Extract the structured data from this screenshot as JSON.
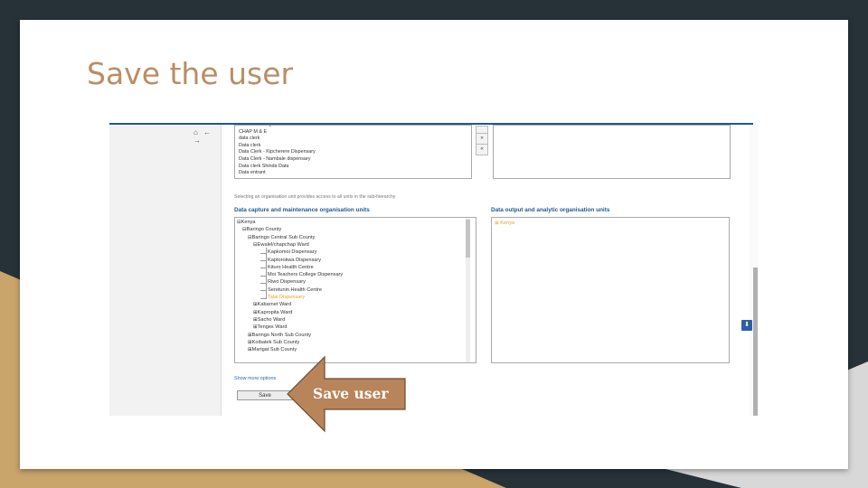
{
  "slide": {
    "title": "Save the user"
  },
  "nav": {
    "icons": [
      "home-icon",
      "back-arrow-icon",
      "forward-arrow-icon"
    ],
    "icons_text": "⌂ ← →"
  },
  "roles": {
    "available": [
      "CHAP IP Manger",
      "CHAP M & E",
      "data clerk",
      "Data clerk",
      "Data Clerk - Kipcherere Dispensary",
      "Data Clerk - Nambale dispensary",
      "Data clerk Shinda Data",
      "Data entrant"
    ],
    "move_buttons": [
      "»",
      "«"
    ]
  },
  "org": {
    "note": "Selecting an organisation unit provides access to all units in the sub-hierarchy",
    "capture_heading": "Data capture and maintenance organisation units",
    "output_heading": "Data output and analytic organisation units",
    "tree": [
      {
        "label": "⊟Kenya"
      },
      {
        "label": "⊟Baringo County"
      },
      {
        "label": "⊟Baringo Central Sub County"
      },
      {
        "label": "⊟Ewalel/chapchap Ward"
      },
      {
        "label": "Kapkomoi Dispensary"
      },
      {
        "label": "Kaptorokwa Dispensary"
      },
      {
        "label": "Kituro Health Centre"
      },
      {
        "label": "Moi Teachers College Dispensary"
      },
      {
        "label": "Riwo Dispensary"
      },
      {
        "label": "Seretunin Health Centre"
      },
      {
        "label": "Talai Dispensary",
        "selected": true
      },
      {
        "label": "⊞Kabarnet Ward"
      },
      {
        "label": "⊞Kapropita Ward"
      },
      {
        "label": "⊞Sacho Ward"
      },
      {
        "label": "⊞Tenges Ward"
      },
      {
        "label": "⊞Baringo North Sub County"
      },
      {
        "label": "⊞Koibatek Sub County"
      },
      {
        "label": "⊞Marigat Sub County"
      }
    ],
    "output_selected": "⊞ Kenya"
  },
  "actions": {
    "more_options": "Show more options",
    "save": "Save"
  },
  "callout": {
    "text": "Save user",
    "color": "#b8845a",
    "border": "#6b4a2e"
  },
  "colors": {
    "title": "#b98e66",
    "link": "#2a67b8",
    "heading": "#1d5a8c",
    "selected": "#e8a320"
  }
}
